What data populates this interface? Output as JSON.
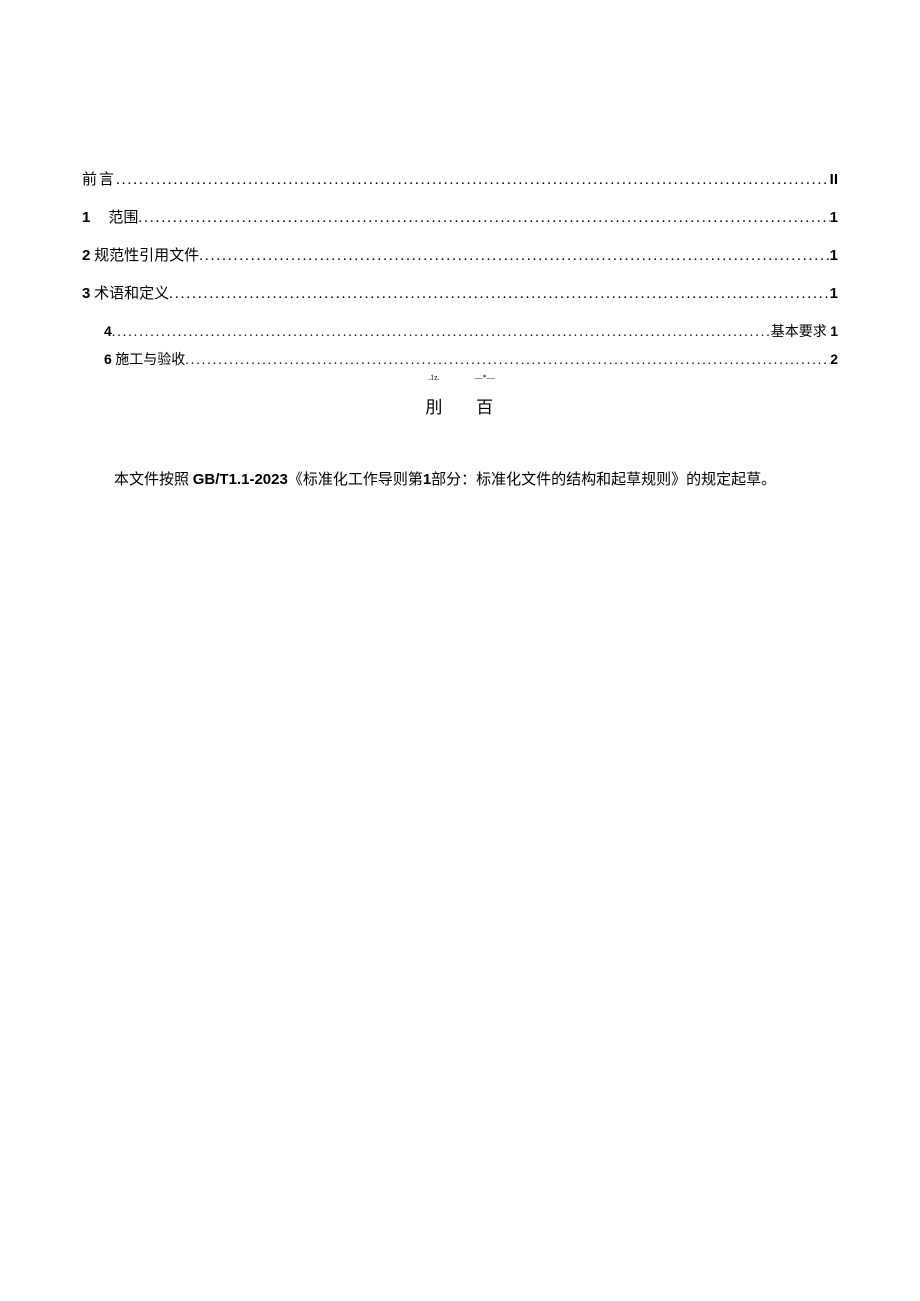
{
  "toc": {
    "items": [
      {
        "label_pre": "前",
        "label_post": "言",
        "page": "II",
        "indent": 0,
        "bold_page": true,
        "spaced": true
      },
      {
        "label_pre": "1",
        "label_post": "范围",
        "gap": true,
        "page": "1",
        "indent": 0,
        "bold_num": true,
        "bold_page": true
      },
      {
        "label_pre": "2",
        "label_post": "规范性引用文件",
        "page": "1",
        "indent": 0,
        "bold_num": true,
        "bold_page": true
      },
      {
        "label_pre": "3",
        "label_post": "术语和定义",
        "page": "1",
        "indent": 0,
        "bold_num": true,
        "bold_page": true
      },
      {
        "label_pre": "4",
        "label_post": "",
        "page_prefix": "基本要求",
        "page": "1",
        "indent": 1,
        "bold_num": true,
        "bold_page": true,
        "tight": true
      },
      {
        "label_pre": "6",
        "label_post": "施工与验收",
        "page": "2",
        "indent": 1,
        "bold_num": true,
        "bold_page": true,
        "tight": true
      }
    ]
  },
  "mid_mark": {
    "tiny_left": ".1z.",
    "char_left": "刖",
    "tiny_right": "—*—",
    "char_right": "百"
  },
  "paragraph": {
    "pre": "本文件按照 ",
    "std_code": "GB/T1.1-2023",
    "mid1": "《标准化工作导则第",
    "one": "1",
    "mid2": "部分：标准化文件的结构和起草规则》的规定起草。"
  }
}
